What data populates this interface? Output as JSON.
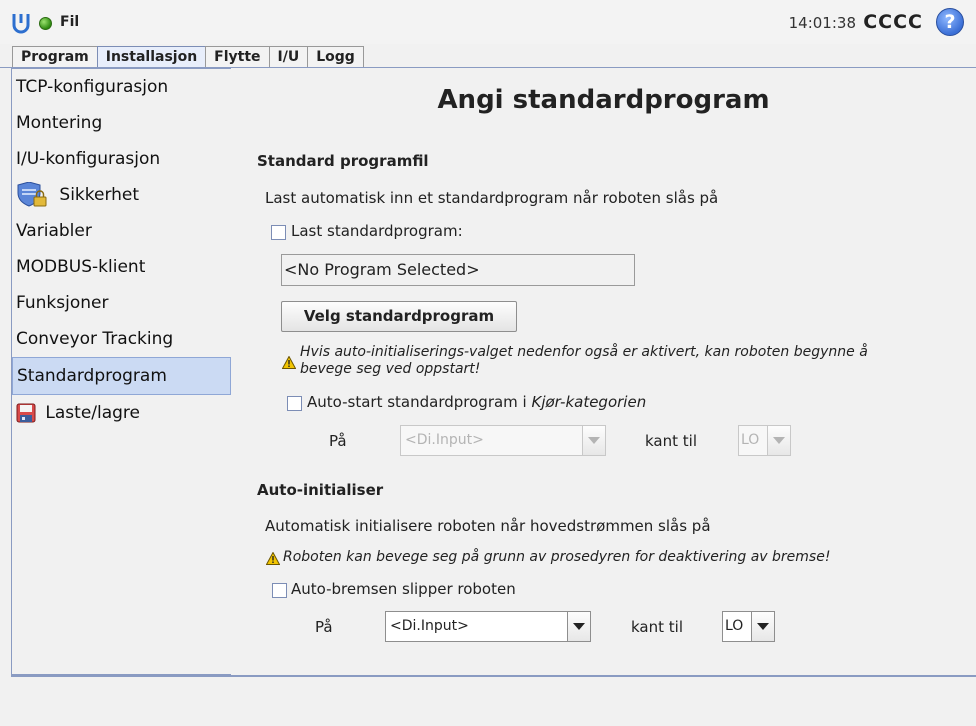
{
  "header": {
    "menu_label": "Fil",
    "time": "14:01:38",
    "robot_name": "CCCC",
    "help_symbol": "?"
  },
  "tabs": [
    {
      "label": "Program",
      "active": false
    },
    {
      "label": "Installasjon",
      "active": true
    },
    {
      "label": "Flytte",
      "active": false
    },
    {
      "label": "I/U",
      "active": false
    },
    {
      "label": "Logg",
      "active": false
    }
  ],
  "sidebar": {
    "items": [
      {
        "label": "TCP-konfigurasjon",
        "icon": ""
      },
      {
        "label": "Montering",
        "icon": ""
      },
      {
        "label": "I/U-konfigurasjon",
        "icon": ""
      },
      {
        "label": "Sikkerhet",
        "icon": "shield-lock-icon"
      },
      {
        "label": "Variabler",
        "icon": ""
      },
      {
        "label": "MODBUS-klient",
        "icon": ""
      },
      {
        "label": "Funksjoner",
        "icon": ""
      },
      {
        "label": "Conveyor Tracking",
        "icon": ""
      },
      {
        "label": "Standardprogram",
        "icon": "",
        "active": true
      },
      {
        "label": "Laste/lagre",
        "icon": "floppy-disk-icon"
      }
    ]
  },
  "main": {
    "title": "Angi standardprogram",
    "default_file": {
      "heading": "Standard programfil",
      "description": "Last automatisk inn et standardprogram når roboten slås på",
      "load_checkbox_label": "Last standardprogram:",
      "load_checked": false,
      "program_path": "<No Program Selected>",
      "select_button": "Velg standardprogram",
      "warning_line1": "Hvis auto-initialiserings-valget nedenfor også er aktivert, kan roboten begynne å",
      "warning_line2": "bevege seg ved oppstart!",
      "autostart_label_prefix": "Auto-start standardprogram i ",
      "autostart_label_italic": "Kjør-kategorien",
      "autostart_checked": false,
      "on_label": "På",
      "input_value": "<Di.Input>",
      "edge_label": "kant til",
      "edge_value": "LO"
    },
    "auto_init": {
      "heading": "Auto-initialiser",
      "description": "Automatisk initialisere roboten når hovedstrømmen slås på",
      "warning": "Roboten kan bevege seg på grunn av prosedyren for deaktivering av bremse!",
      "brake_label": "Auto-bremsen slipper roboten",
      "brake_checked": false,
      "on_label": "På",
      "input_value": "<Di.Input>",
      "edge_label": "kant til",
      "edge_value": "LO"
    }
  },
  "colors": {
    "accent_border": "#8a9bc2",
    "selected_bg": "#cbdaf3",
    "warning_yellow": "#f2c500"
  }
}
